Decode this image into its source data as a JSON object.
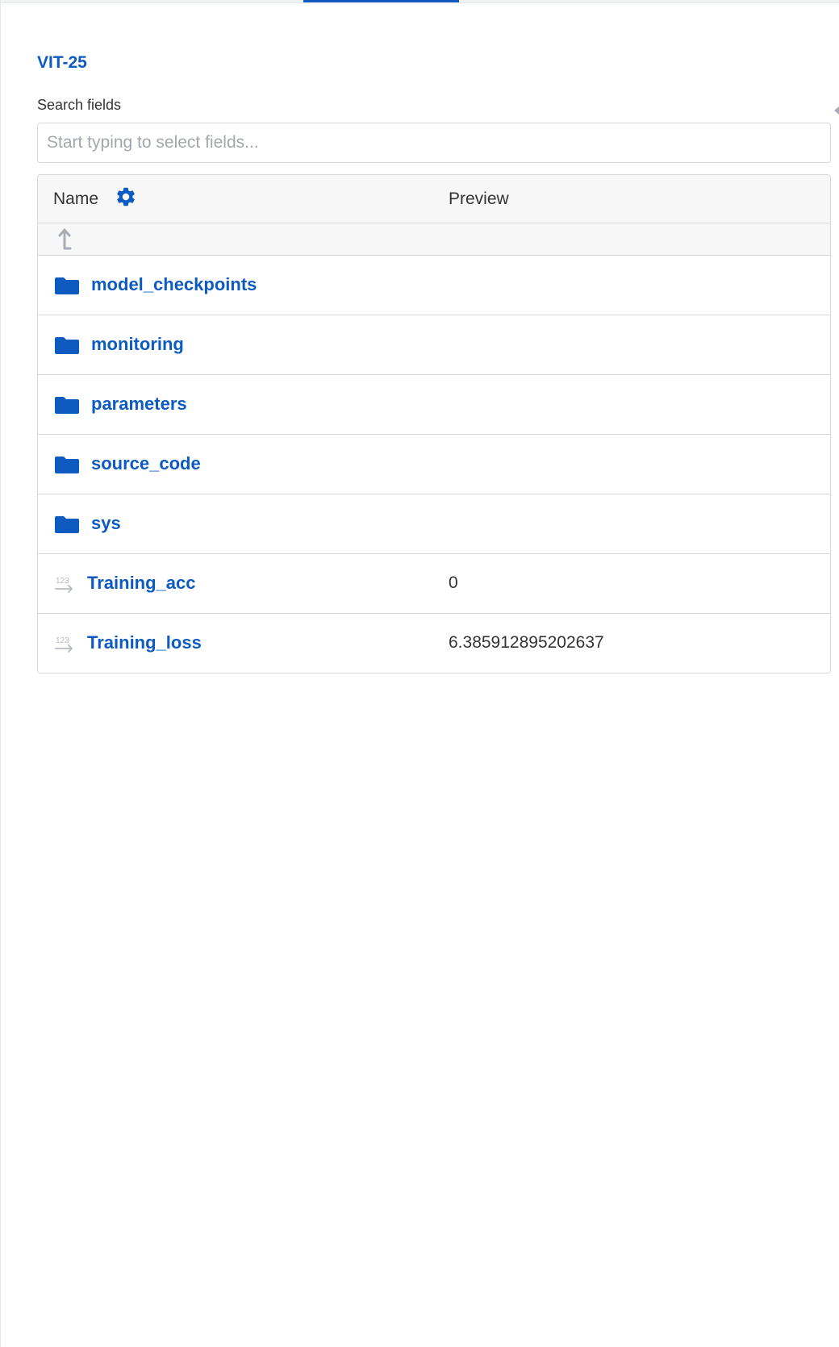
{
  "run": {
    "title": "VIT-25"
  },
  "search": {
    "label": "Search fields",
    "placeholder": "Start typing to select fields...",
    "value": ""
  },
  "table": {
    "columns": {
      "name": "Name",
      "preview": "Preview"
    },
    "rows": [
      {
        "name": "model_checkpoints",
        "type": "folder",
        "preview": ""
      },
      {
        "name": "monitoring",
        "type": "folder",
        "preview": ""
      },
      {
        "name": "parameters",
        "type": "folder",
        "preview": ""
      },
      {
        "name": "source_code",
        "type": "folder",
        "preview": ""
      },
      {
        "name": "sys",
        "type": "folder",
        "preview": ""
      },
      {
        "name": "Training_acc",
        "type": "numeric",
        "preview": "0"
      },
      {
        "name": "Training_loss",
        "type": "numeric",
        "preview": "6.385912895202637"
      }
    ]
  },
  "icons": {
    "settings": "gear-icon",
    "parent": "arrow-up-icon",
    "folder": "folder-icon",
    "numeric": "numeric-field-icon"
  },
  "colors": {
    "accent": "#0d5bc0",
    "text": "#333333",
    "border": "#d5d8dc",
    "header_bg": "#f7f7f8"
  }
}
